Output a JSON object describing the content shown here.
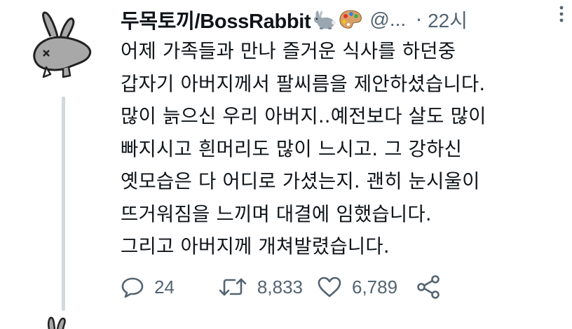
{
  "author": {
    "display_name": "두목토끼/BossRabbit",
    "handle": "@...",
    "separator": "·",
    "time_ago": "22시"
  },
  "tweet": {
    "lines": [
      "어제 가족들과 만나 즐거운 식사를 하던중",
      "갑자기 아버지께서 팔씨름을 제안하셨습니다.",
      "많이 늙으신 우리 아버지..예전보다 살도 많이",
      "빠지시고 흰머리도 많이 느시고. 그 강하신",
      "옛모습은 다 어디로 가셨는지. 괜히 눈시울이",
      "뜨거워짐을 느끼며 대결에 임했습니다.",
      "그리고 아버지께 개쳐발렸습니다."
    ]
  },
  "actions": {
    "replies": "24",
    "retweets": "8,833",
    "likes": "6,789"
  },
  "icons": {
    "name_emojis": [
      "rabbit-icon",
      "palette-icon"
    ],
    "more": "more-icon",
    "reply": "reply-icon",
    "retweet": "retweet-icon",
    "like": "heart-icon",
    "share": "share-icon"
  },
  "colors": {
    "text": "#0f1419",
    "secondary": "#536471",
    "thread_line": "#cfd9de"
  }
}
